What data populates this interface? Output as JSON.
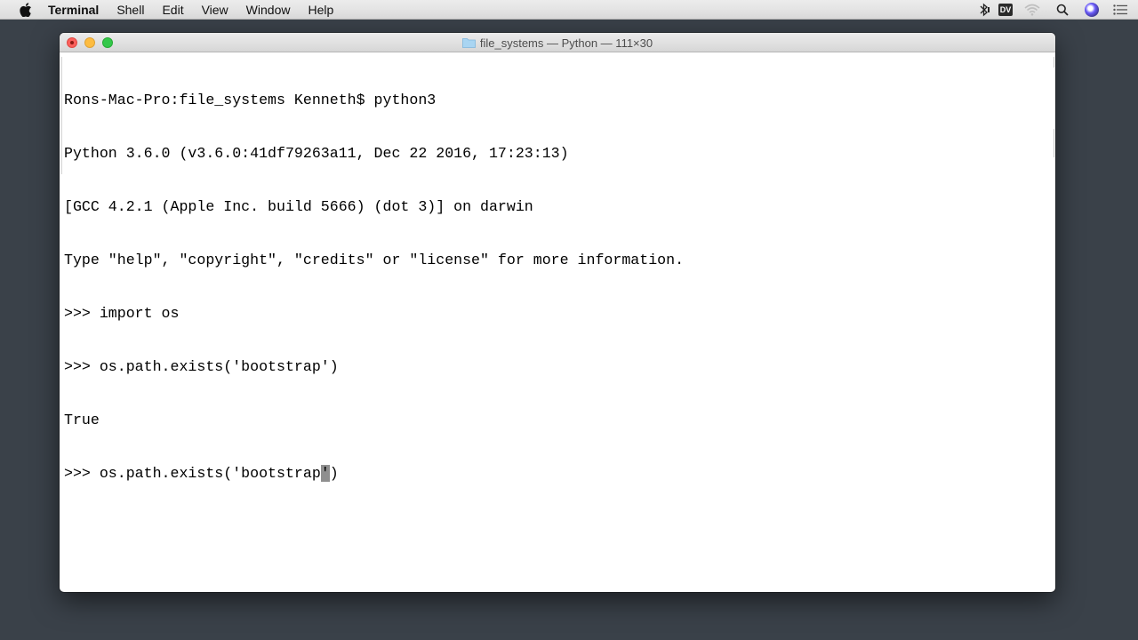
{
  "menubar": {
    "app_name": "Terminal",
    "items": [
      "Shell",
      "Edit",
      "View",
      "Window",
      "Help"
    ],
    "status": {
      "dv_label": "DV"
    }
  },
  "window": {
    "title": "file_systems — Python — 111×30",
    "lines": [
      "Rons-Mac-Pro:file_systems Kenneth$ python3",
      "Python 3.6.0 (v3.6.0:41df79263a11, Dec 22 2016, 17:23:13)",
      "[GCC 4.2.1 (Apple Inc. build 5666) (dot 3)] on darwin",
      "Type \"help\", \"copyright\", \"credits\" or \"license\" for more information.",
      ">>> import os",
      ">>> os.path.exists('bootstrap')",
      "True"
    ],
    "current_line": {
      "before_cursor": ">>> os.path.exists('bootstrap",
      "cursor_char": "'",
      "after_cursor": ")"
    }
  },
  "colors": {
    "desktop": "#3a4149",
    "close": "#fc605c",
    "minimize": "#fdbc40",
    "zoom": "#34c84a",
    "cursor": "#8f8f8f"
  }
}
